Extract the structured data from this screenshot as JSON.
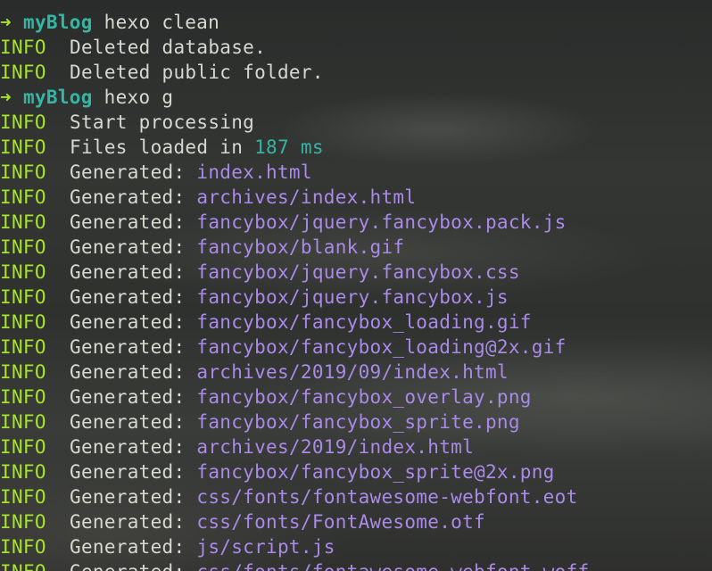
{
  "terminal": {
    "lines": [
      {
        "type": "prompt",
        "arrow": "➜",
        "dir": "myBlog",
        "command": "hexo clean"
      },
      {
        "type": "info",
        "level": "INFO",
        "message": "Deleted database."
      },
      {
        "type": "info",
        "level": "INFO",
        "message": "Deleted public folder."
      },
      {
        "type": "prompt",
        "arrow": "➜",
        "dir": "myBlog",
        "command": "hexo g"
      },
      {
        "type": "info",
        "level": "INFO",
        "message": "Start processing"
      },
      {
        "type": "info",
        "level": "INFO",
        "message": "Files loaded in",
        "highlight": "187 ms"
      },
      {
        "type": "generated",
        "level": "INFO",
        "message": "Generated:",
        "file": "index.html"
      },
      {
        "type": "generated",
        "level": "INFO",
        "message": "Generated:",
        "file": "archives/index.html"
      },
      {
        "type": "generated",
        "level": "INFO",
        "message": "Generated:",
        "file": "fancybox/jquery.fancybox.pack.js"
      },
      {
        "type": "generated",
        "level": "INFO",
        "message": "Generated:",
        "file": "fancybox/blank.gif"
      },
      {
        "type": "generated",
        "level": "INFO",
        "message": "Generated:",
        "file": "fancybox/jquery.fancybox.css"
      },
      {
        "type": "generated",
        "level": "INFO",
        "message": "Generated:",
        "file": "fancybox/jquery.fancybox.js"
      },
      {
        "type": "generated",
        "level": "INFO",
        "message": "Generated:",
        "file": "fancybox/fancybox_loading.gif"
      },
      {
        "type": "generated",
        "level": "INFO",
        "message": "Generated:",
        "file": "fancybox/fancybox_loading@2x.gif"
      },
      {
        "type": "generated",
        "level": "INFO",
        "message": "Generated:",
        "file": "archives/2019/09/index.html"
      },
      {
        "type": "generated",
        "level": "INFO",
        "message": "Generated:",
        "file": "fancybox/fancybox_overlay.png"
      },
      {
        "type": "generated",
        "level": "INFO",
        "message": "Generated:",
        "file": "fancybox/fancybox_sprite.png"
      },
      {
        "type": "generated",
        "level": "INFO",
        "message": "Generated:",
        "file": "archives/2019/index.html"
      },
      {
        "type": "generated",
        "level": "INFO",
        "message": "Generated:",
        "file": "fancybox/fancybox_sprite@2x.png"
      },
      {
        "type": "generated",
        "level": "INFO",
        "message": "Generated:",
        "file": "css/fonts/fontawesome-webfont.eot"
      },
      {
        "type": "generated",
        "level": "INFO",
        "message": "Generated:",
        "file": "css/fonts/FontAwesome.otf"
      },
      {
        "type": "generated",
        "level": "INFO",
        "message": "Generated:",
        "file": "js/script.js"
      },
      {
        "type": "generated",
        "level": "INFO",
        "message": "Generated:",
        "file": "css/fonts/fontawesome-webfont.woff"
      }
    ]
  },
  "colors": {
    "prompt_arrow": "#a6e22e",
    "prompt_dir": "#35b5a4",
    "info_level": "#a6e22e",
    "text": "#d8d8d0",
    "file_path": "#a98ae8",
    "number": "#35b5a4"
  }
}
